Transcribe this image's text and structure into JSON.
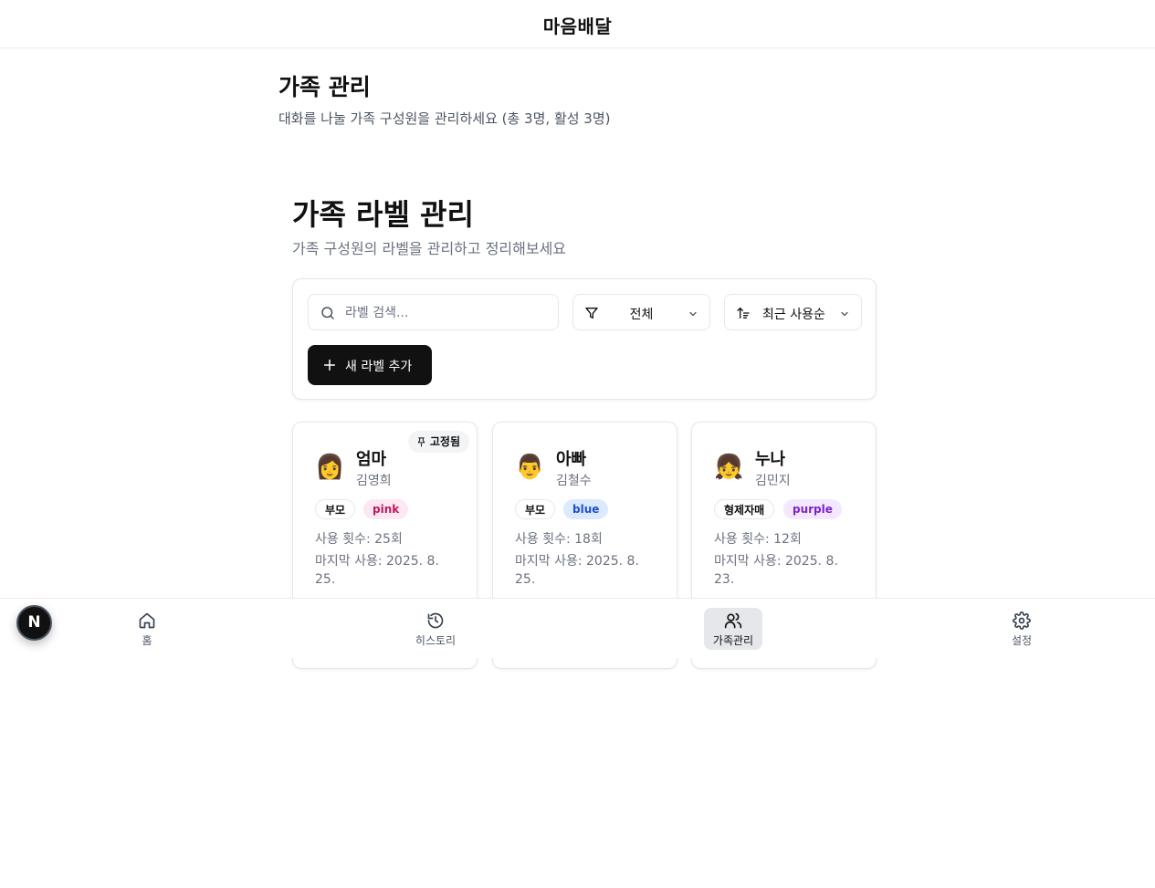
{
  "app": {
    "title": "마음배달"
  },
  "page": {
    "title": "가족 관리",
    "subtitle": "대화를 나눌 가족 구성원을 관리하세요 (총 3명, 활성 3명)"
  },
  "section": {
    "title": "가족 라벨 관리",
    "subtitle": "가족 구성원의 라벨을 관리하고 정리해보세요"
  },
  "toolbar": {
    "search_placeholder": "라벨 검색...",
    "search_value": "",
    "filter_value": "전체",
    "sort_value": "최근 사용순",
    "add_label": "새 라벨 추가"
  },
  "cards": [
    {
      "emoji": "👩",
      "label": "엄마",
      "name": "김영희",
      "category": "부모",
      "color": "pink",
      "usage": "사용 횟수: 25회",
      "last_used": "마지막 사용: 2025. 8. 25.",
      "pinned": true,
      "pinned_label": "고정됨",
      "tag_bg": "#fce7f3",
      "tag_fg": "#be185d"
    },
    {
      "emoji": "👨",
      "label": "아빠",
      "name": "김철수",
      "category": "부모",
      "color": "blue",
      "usage": "사용 횟수: 18회",
      "last_used": "마지막 사용: 2025. 8. 25.",
      "pinned": false,
      "tag_bg": "#dbeafe",
      "tag_fg": "#1d4ed8"
    },
    {
      "emoji": "👧",
      "label": "누나",
      "name": "김민지",
      "category": "형제자매",
      "color": "purple",
      "usage": "사용 횟수: 12회",
      "last_used": "마지막 사용: 2025. 8. 23.",
      "pinned": false,
      "tag_bg": "#f3e8ff",
      "tag_fg": "#7e22ce"
    }
  ],
  "nav": {
    "items": [
      {
        "label": "홈",
        "icon": "home-icon",
        "active": false
      },
      {
        "label": "히스토리",
        "icon": "history-icon",
        "active": false
      },
      {
        "label": "가족관리",
        "icon": "users-icon",
        "active": true
      },
      {
        "label": "설정",
        "icon": "gear-icon",
        "active": false
      }
    ]
  },
  "badge": {
    "letter": "N"
  },
  "colors": {
    "primary": "#111111",
    "border": "#e5e7eb",
    "muted": "#6b7280"
  }
}
